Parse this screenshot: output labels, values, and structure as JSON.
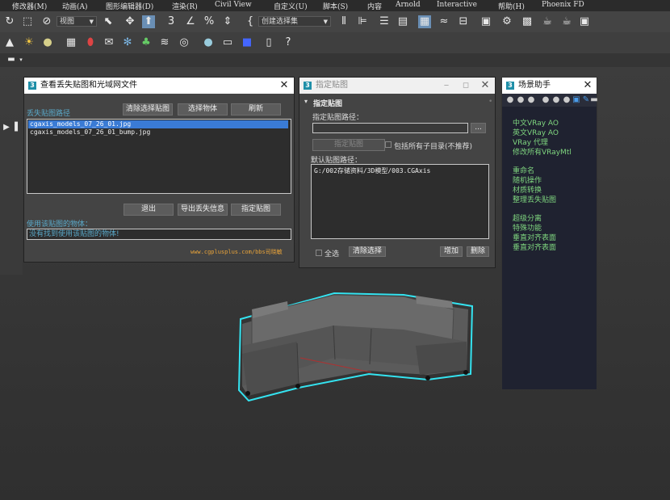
{
  "menubar": [
    "修改器(M)",
    "动画(A)",
    "图形编辑器(D)",
    "渲染(R)",
    "Civil View",
    "自定义(U)",
    "脚本(S)",
    "内容",
    "Arnold",
    "Interactive",
    "帮助(H)",
    "Phoenix FD"
  ],
  "toolbar": {
    "view_dropdown": "视图",
    "selection_set_dropdown": "创建选择集",
    "percent_glyph": "%"
  },
  "missing_dialog": {
    "title": "查看丢失贴图和光域网文件",
    "missing_path_label": "丢失贴图路径",
    "btn_clear_selected": "清除选择贴图",
    "btn_select_object": "选择物体",
    "btn_refresh": "刷新",
    "files": [
      "cgaxis_models_07_26_01.jpg",
      "cgaxis_models_07_26_01_bump.jpg"
    ],
    "btn_exit": "退出",
    "btn_export": "导出丢失信息",
    "btn_assign": "指定贴图",
    "using_objects_label": "使用该贴图的物体：",
    "using_objects_value": "没有找到使用该贴图的物体!",
    "watermark": "www.cgplusplus.com/bbs司晓敏"
  },
  "assign_dialog": {
    "title": "指定贴图",
    "rollout_title": "指定贴图",
    "path_label": "指定贴图路径：",
    "path_value": "",
    "browse_label": "...",
    "btn_assign": "指定贴图",
    "include_subdirs": "包括所有子目录(不推荐)",
    "default_path_label": "默认贴图路径：",
    "default_paths": [
      "G:/002存储资料/3D模型/003.CGAxis"
    ],
    "select_all": "全选",
    "btn_clear": "清除选择",
    "btn_add": "增加",
    "btn_delete": "删除"
  },
  "scene_helper": {
    "title": "场景助手",
    "groups": [
      [
        "中文VRay AO",
        "英文VRay AO",
        "VRay 代理",
        "修改所有VRayMtl"
      ],
      [
        "重命名",
        "随机操作",
        "材质转换",
        "整理丢失贴图"
      ],
      [
        "超级分离",
        "特殊功能",
        "垂直对齐表面",
        "垂直对齐表面"
      ]
    ]
  },
  "colors": {
    "accent_teal": "#1f8fa8",
    "list_selection": "#3a7bd5",
    "helper_text": "#7fd67f",
    "watermark": "#e8a33a"
  }
}
